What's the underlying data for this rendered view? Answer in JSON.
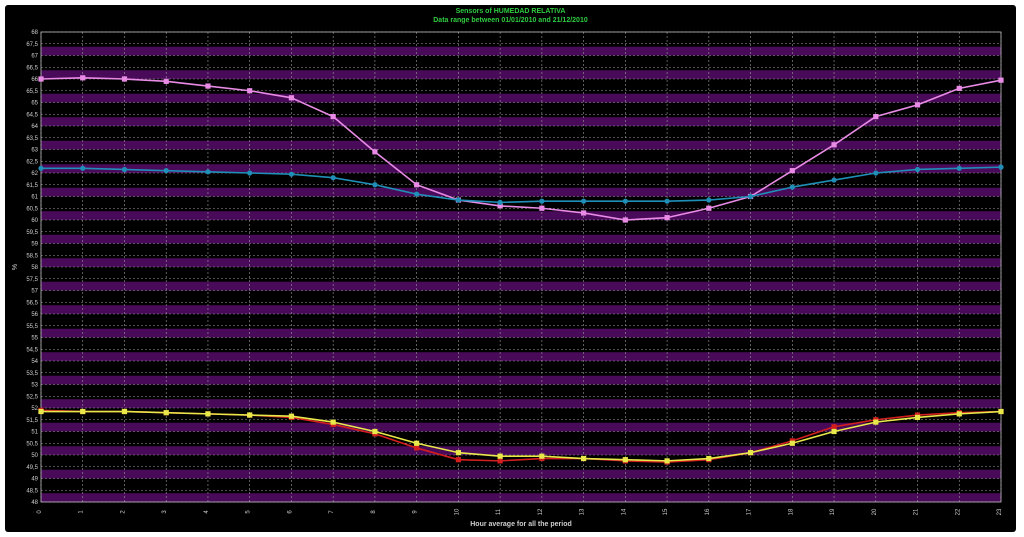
{
  "title": "Sensors of  HUMEDAD RELATIVA",
  "subtitle": "Data range between 01/01/2010 and 21/12/2010",
  "colors": {
    "background": "#000000",
    "band": "#4a0a5a",
    "grid": "#9a9a9a",
    "text": "#cfcfcf",
    "title": "#2ecc40"
  },
  "chart_data": {
    "type": "line",
    "title": "Sensors of  HUMEDAD RELATIVA",
    "subtitle": "Data range between 01/01/2010 and 21/12/2010",
    "xlabel": "Hour average for all the period",
    "ylabel": "%",
    "xlim": [
      0,
      23
    ],
    "ylim": [
      48,
      68
    ],
    "yticks": [
      "48",
      "48,5",
      "49",
      "49,5",
      "50",
      "50,5",
      "51",
      "51,5",
      "52",
      "52,5",
      "53",
      "53,5",
      "54",
      "54,5",
      "55",
      "55,5",
      "56",
      "56,5",
      "57",
      "57,5",
      "58",
      "58,5",
      "59",
      "59,5",
      "60",
      "60,5",
      "61",
      "61,5",
      "62",
      "62,5",
      "63",
      "63,5",
      "64",
      "64,5",
      "65",
      "65,5",
      "66",
      "66,5",
      "67",
      "67,5",
      "68"
    ],
    "x": [
      0,
      1,
      2,
      3,
      4,
      5,
      6,
      7,
      8,
      9,
      10,
      11,
      12,
      13,
      14,
      15,
      16,
      17,
      18,
      19,
      20,
      21,
      22,
      23
    ],
    "grid": true,
    "series": [
      {
        "color": "#e98be6",
        "values": [
          66.0,
          66.05,
          66.0,
          65.9,
          65.7,
          65.5,
          65.2,
          64.4,
          62.9,
          61.5,
          60.85,
          60.6,
          60.5,
          60.3,
          60.0,
          60.1,
          60.5,
          61.0,
          62.1,
          63.2,
          64.4,
          64.9,
          65.6,
          65.95
        ]
      },
      {
        "color": "#1f8fb8",
        "values": [
          62.2,
          62.2,
          62.15,
          62.1,
          62.05,
          62.0,
          61.95,
          61.8,
          61.5,
          61.1,
          60.85,
          60.75,
          60.8,
          60.8,
          60.8,
          60.8,
          60.85,
          61.0,
          61.4,
          61.7,
          62.0,
          62.15,
          62.2,
          62.25
        ]
      },
      {
        "color": "#d21e1e",
        "values": [
          51.9,
          51.85,
          51.85,
          51.8,
          51.75,
          51.7,
          51.6,
          51.3,
          50.9,
          50.3,
          49.8,
          49.75,
          49.85,
          49.85,
          49.75,
          49.7,
          49.8,
          50.1,
          50.6,
          51.2,
          51.5,
          51.7,
          51.8,
          51.85
        ]
      },
      {
        "color": "#e8e84a",
        "values": [
          51.85,
          51.85,
          51.85,
          51.8,
          51.75,
          51.7,
          51.65,
          51.4,
          51.0,
          50.5,
          50.1,
          49.95,
          49.95,
          49.85,
          49.8,
          49.75,
          49.85,
          50.1,
          50.5,
          51.0,
          51.4,
          51.6,
          51.75,
          51.85
        ]
      }
    ]
  }
}
